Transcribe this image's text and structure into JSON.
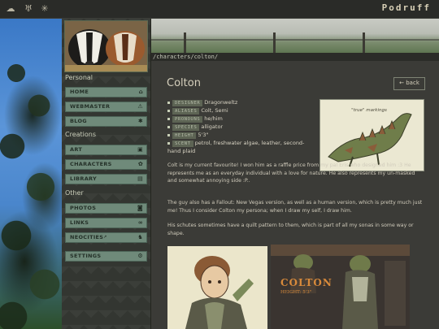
{
  "site": {
    "brand": "Podruff"
  },
  "topbar": {
    "icons": [
      "sheep-icon",
      "tooth-icon",
      "sun-icon"
    ]
  },
  "sidebar": {
    "sections": [
      {
        "label": "Personal",
        "items": [
          {
            "label": "HOME",
            "icon": "home-icon"
          },
          {
            "label": "WEBMASTER",
            "icon": "warning-icon"
          },
          {
            "label": "BLOG",
            "icon": "sun-icon"
          }
        ]
      },
      {
        "label": "Creations",
        "items": [
          {
            "label": "ART",
            "icon": "image-icon"
          },
          {
            "label": "CHARACTERS",
            "icon": "paw-icon"
          },
          {
            "label": "LIBRARY",
            "icon": "book-icon"
          }
        ]
      },
      {
        "label": "Other",
        "items": [
          {
            "label": "PHOTOS",
            "icon": "camera-icon"
          },
          {
            "label": "LINKS",
            "icon": "link-icon"
          },
          {
            "label": "NEOCITIES",
            "icon": "cat-icon"
          }
        ]
      },
      {
        "label": "",
        "items": [
          {
            "label": "SETTINGS",
            "icon": "gear-icon"
          }
        ]
      }
    ]
  },
  "path": "/characters/colton/",
  "page": {
    "title": "Colton",
    "back_label": "back",
    "info": [
      {
        "key": "DESIGNER",
        "value": "Dragonweltz"
      },
      {
        "key": "ALIASES",
        "value": "Colt, Semi"
      },
      {
        "key": "PRONOUNS",
        "value": "he/him"
      },
      {
        "key": "SPECIES",
        "value": "alligator"
      },
      {
        "key": "HEIGHT",
        "value": "5'3\""
      },
      {
        "key": "SCENT",
        "value": "petrol, freshwater algae, leather, second-hand plaid"
      }
    ],
    "ref_note": "\"true\" markings",
    "para1": "Colt is my current favourite! I won him as a raffle price from my pal Eris who designed him :3 He represents me as an everyday individual with a love for nature. He also represents my un-masked and somewhat annoying side :P..",
    "para2": "The guy also has a Fallout: New Vegas version, as well as a human version, which is pretty much just me! Thus I consider Colton my persona; when I draw my self, I draw him.",
    "para3": "His schutes sometimes have a quilt pattern to them, which is part of all my sonas in some way or shape.",
    "sheet_title": "COLTON",
    "sheet_sub": "HEIGHT: 5'3\""
  }
}
